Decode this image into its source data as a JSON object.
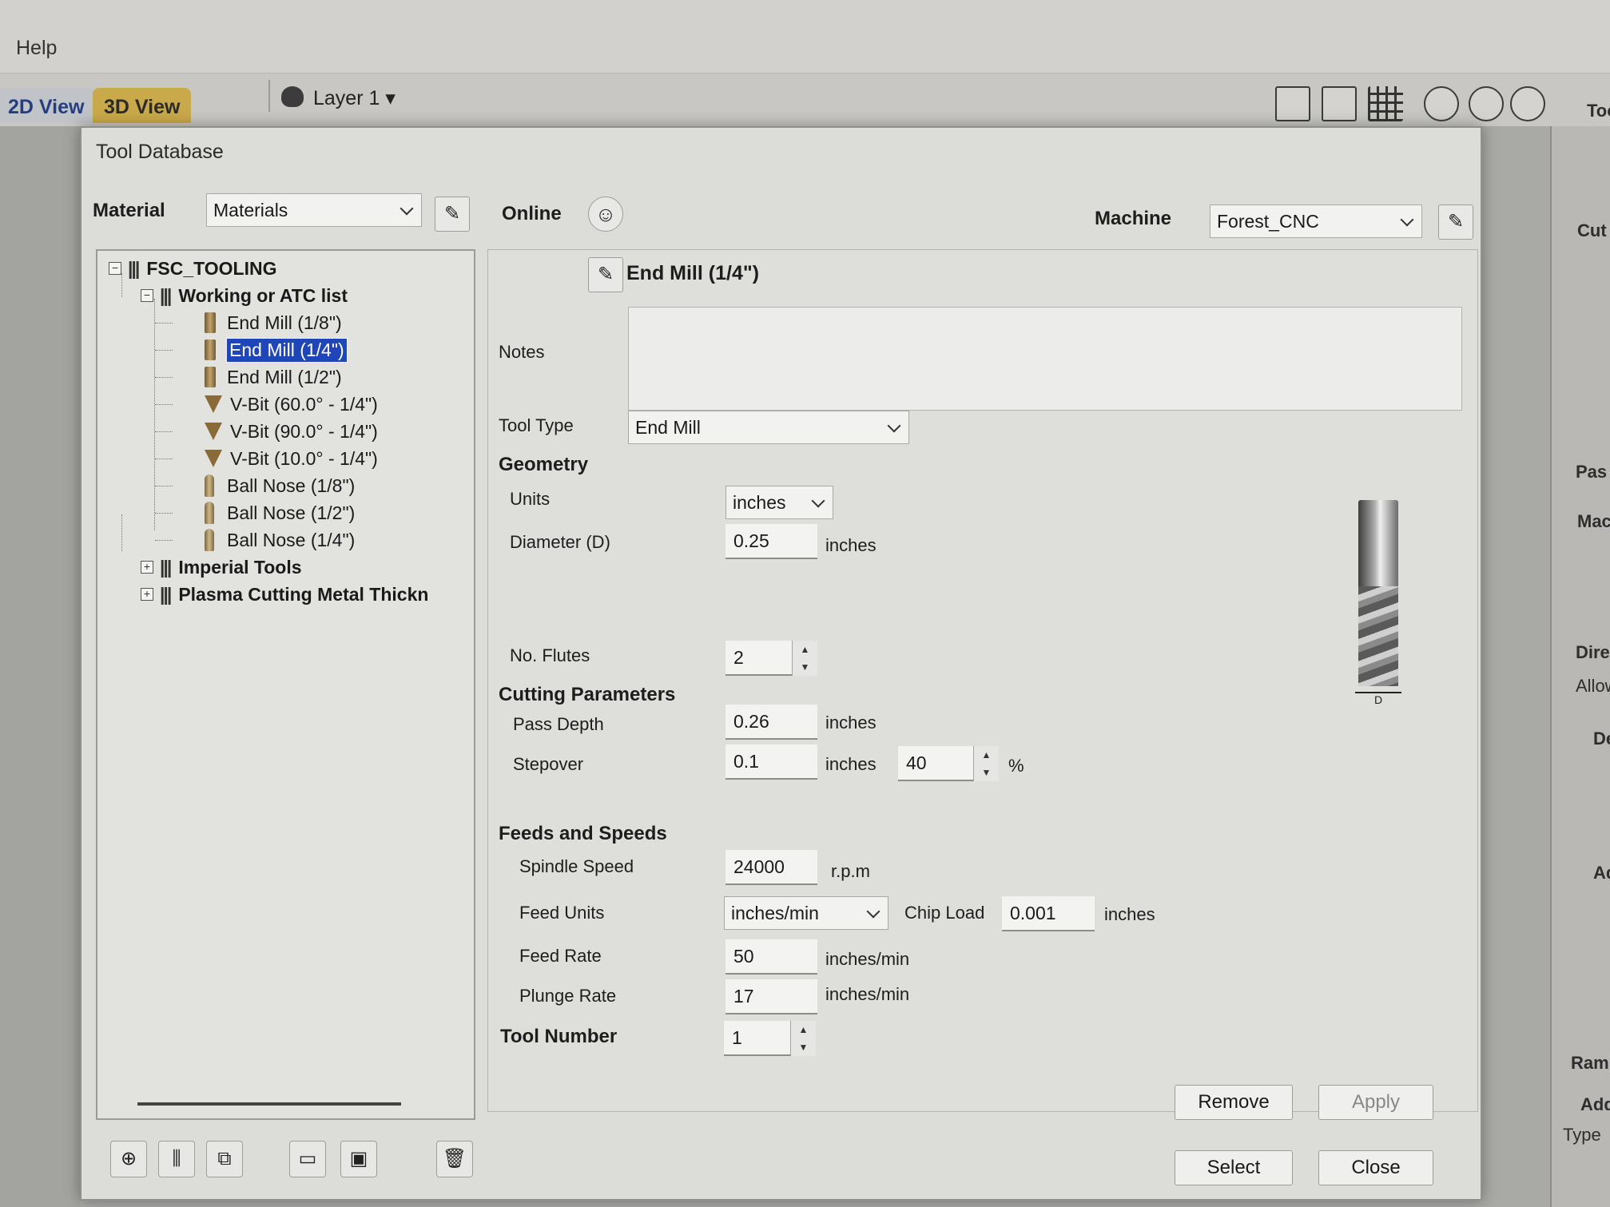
{
  "app": {
    "menu_help": "Help",
    "tab_2d": "2D View",
    "tab_3d": "3D View",
    "layer_label": "Layer 1 ▾",
    "right_panel_texts": [
      "Too",
      "Cut",
      "Pas",
      "Mac",
      "Dire",
      "Allow",
      "De",
      "Ad",
      "Ramp",
      "Add",
      "Type"
    ]
  },
  "dialog": {
    "title": "Tool Database",
    "material_label": "Material",
    "material_value": "Materials",
    "online_label": "Online",
    "machine_label": "Machine",
    "machine_value": "Forest_CNC",
    "tree": {
      "root": "FSC_TOOLING",
      "group_open": "Working or ATC list",
      "tools": [
        "End Mill (1/8\")",
        "End Mill (1/4\")",
        "End Mill (1/2\")",
        "V-Bit (60.0° - 1/4\")",
        "V-Bit (90.0° - 1/4\")",
        "V-Bit (10.0° - 1/4\")",
        "Ball Nose (1/8\")",
        "Ball Nose (1/2\")",
        "Ball Nose (1/4\")"
      ],
      "selected_index": 1,
      "collapsed_groups": [
        "Imperial Tools",
        "Plasma Cutting Metal Thickn"
      ]
    },
    "tool_title": "End Mill (1/4\")",
    "notes_label": "Notes",
    "notes_value": "",
    "tool_type_label": "Tool Type",
    "tool_type_value": "End Mill",
    "geometry": {
      "heading": "Geometry",
      "units_label": "Units",
      "units_value": "inches",
      "diameter_label": "Diameter (D)",
      "diameter_value": "0.25",
      "diameter_unit": "inches",
      "flutes_label": "No. Flutes",
      "flutes_value": "2",
      "dim_marker": "D"
    },
    "cutting": {
      "heading": "Cutting Parameters",
      "pass_depth_label": "Pass Depth",
      "pass_depth_value": "0.26",
      "pass_depth_unit": "inches",
      "stepover_label": "Stepover",
      "stepover_value": "0.1",
      "stepover_unit": "inches",
      "stepover_percent": "40",
      "percent_sign": "%"
    },
    "feeds": {
      "heading": "Feeds and Speeds",
      "spindle_label": "Spindle Speed",
      "spindle_value": "24000",
      "spindle_unit": "r.p.m",
      "feed_units_label": "Feed Units",
      "feed_units_value": "inches/min",
      "chip_load_label": "Chip Load",
      "chip_load_value": "0.001",
      "chip_load_unit": "inches",
      "feed_rate_label": "Feed Rate",
      "feed_rate_value": "50",
      "feed_rate_unit": "inches/min",
      "plunge_label": "Plunge Rate",
      "plunge_value": "17",
      "plunge_unit": "inches/min"
    },
    "tool_number_label": "Tool Number",
    "tool_number_value": "1",
    "buttons": {
      "remove": "Remove",
      "apply": "Apply",
      "select": "Select",
      "close": "Close"
    },
    "colors": {
      "selection": "#1f46b8",
      "tab_3d": "#c9a94a"
    }
  }
}
